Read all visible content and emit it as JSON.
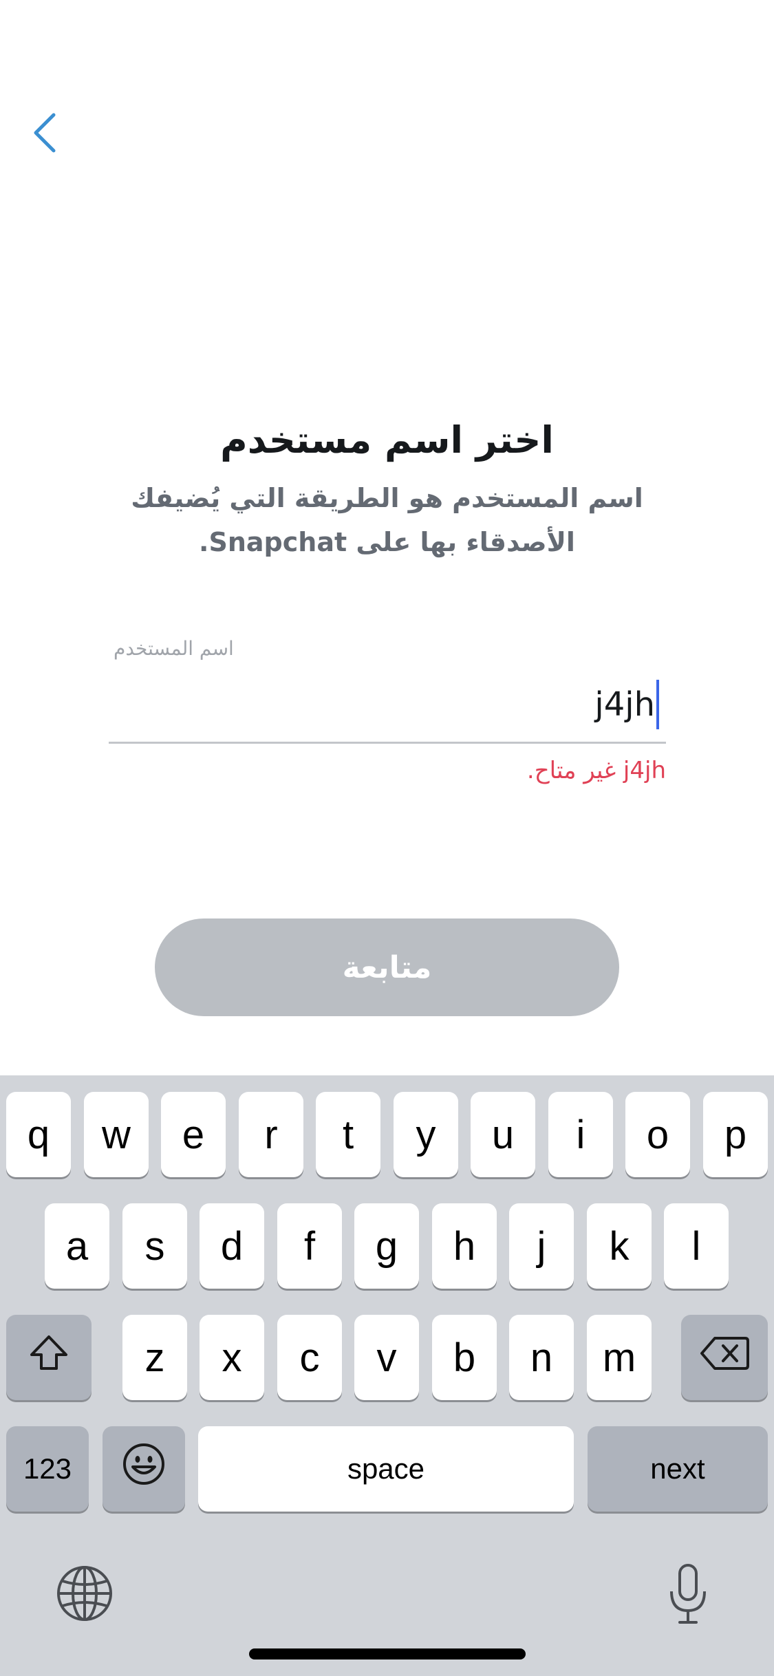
{
  "header": {
    "back_icon": "chevron-left-icon"
  },
  "content": {
    "title": "اختر اسم مستخدم",
    "subtitle": "اسم المستخدم هو الطريقة التي يُضيفك الأصدقاء بها على Snapchat.",
    "field_label": "اسم المستخدم",
    "username_value": "j4jh",
    "error": "j4jh غير متاح.",
    "continue_label": "متابعة"
  },
  "keyboard": {
    "row1": [
      "q",
      "w",
      "e",
      "r",
      "t",
      "y",
      "u",
      "i",
      "o",
      "p"
    ],
    "row2": [
      "a",
      "s",
      "d",
      "f",
      "g",
      "h",
      "j",
      "k",
      "l"
    ],
    "row3": [
      "z",
      "x",
      "c",
      "v",
      "b",
      "n",
      "m"
    ],
    "numbers_label": "123",
    "space_label": "space",
    "next_label": "next",
    "shift_icon": "shift-icon",
    "delete_icon": "delete-icon",
    "emoji_icon": "emoji-icon",
    "globe_icon": "globe-icon",
    "mic_icon": "microphone-icon"
  },
  "colors": {
    "accent": "#3b8fd1",
    "error": "#e04155",
    "button_disabled": "#babec3",
    "caret": "#3b66e8"
  }
}
